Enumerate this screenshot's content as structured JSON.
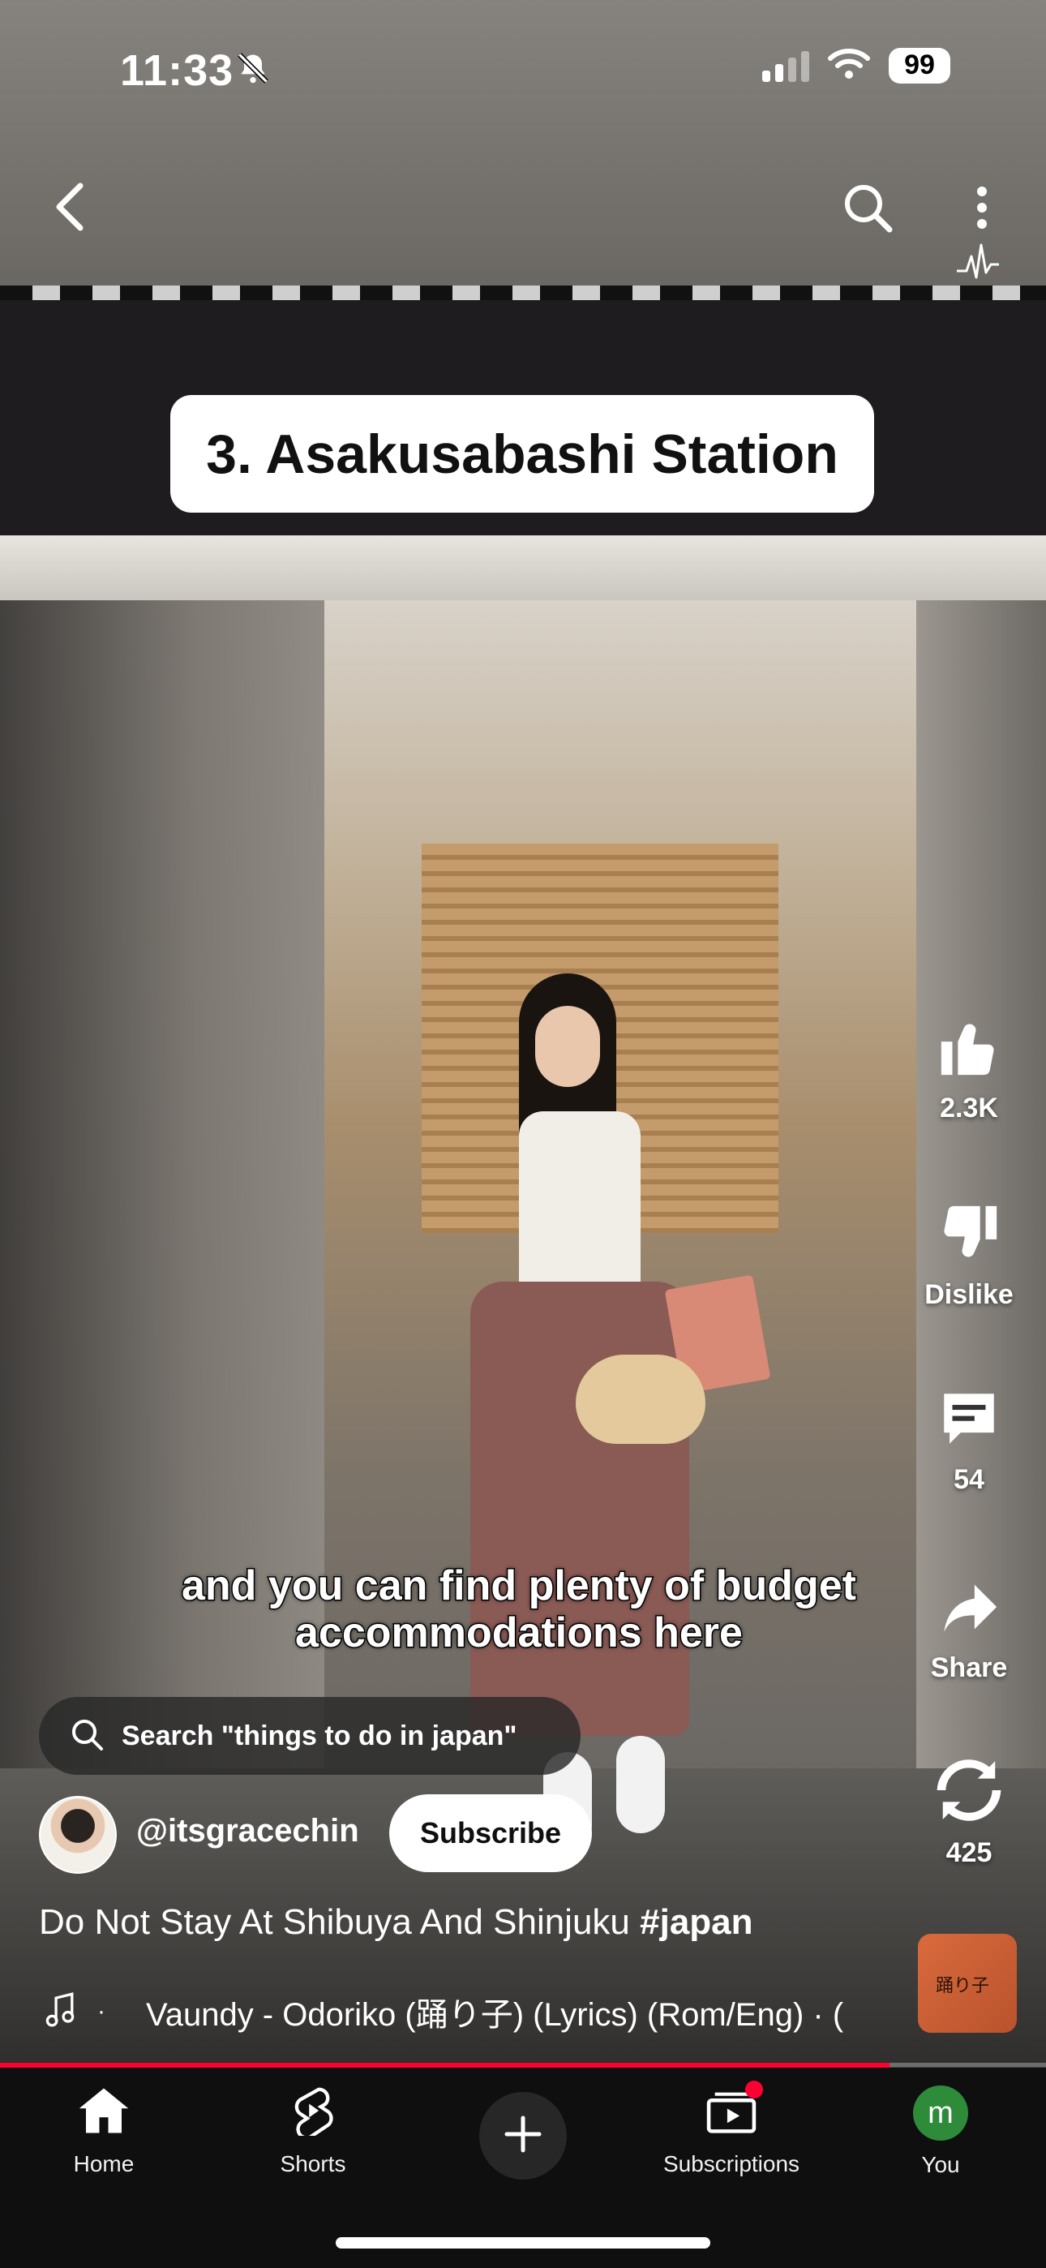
{
  "status_bar": {
    "time": "11:33",
    "battery": "99",
    "icons": [
      "bell-slash-icon",
      "cellular-signal-icon",
      "wifi-icon",
      "battery-icon"
    ]
  },
  "top_nav": {
    "icons": [
      "back-chevron-icon",
      "search-icon",
      "more-vertical-icon",
      "audio-wave-icon"
    ]
  },
  "video": {
    "overlay_title": "3. Asakusabashi Station",
    "caption": "and you can find plenty of budget accommodations here"
  },
  "actions": {
    "like_count": "2.3K",
    "dislike_label": "Dislike",
    "comments_count": "54",
    "share_label": "Share",
    "remix_count": "425"
  },
  "search_suggestion": {
    "text": "Search \"things to do in japan\""
  },
  "channel": {
    "handle": "@itsgracechin",
    "subscribe_label": "Subscribe"
  },
  "title": {
    "text": "Do Not Stay At Shibuya And Shinjuku ",
    "hashtag": "#japan"
  },
  "music": {
    "separator": "·",
    "track": "Vaundy - Odoriko (踊り子) (Lyrics) (Rom/Eng) · (",
    "album_art_text": "踊り子"
  },
  "playback": {
    "progress_fraction": 0.85
  },
  "tabbar": {
    "tabs": [
      {
        "label": "Home",
        "icon": "home-icon"
      },
      {
        "label": "Shorts",
        "icon": "shorts-icon"
      },
      {
        "label": "",
        "icon": "create-plus-icon"
      },
      {
        "label": "Subscriptions",
        "icon": "subscriptions-icon"
      },
      {
        "label": "You",
        "icon": "user-avatar",
        "avatar_letter": "m"
      }
    ]
  },
  "colors": {
    "accent_red": "#ff0033",
    "tabbar_bg": "#0f0f0f",
    "avatar_green": "#2e8b3a"
  }
}
